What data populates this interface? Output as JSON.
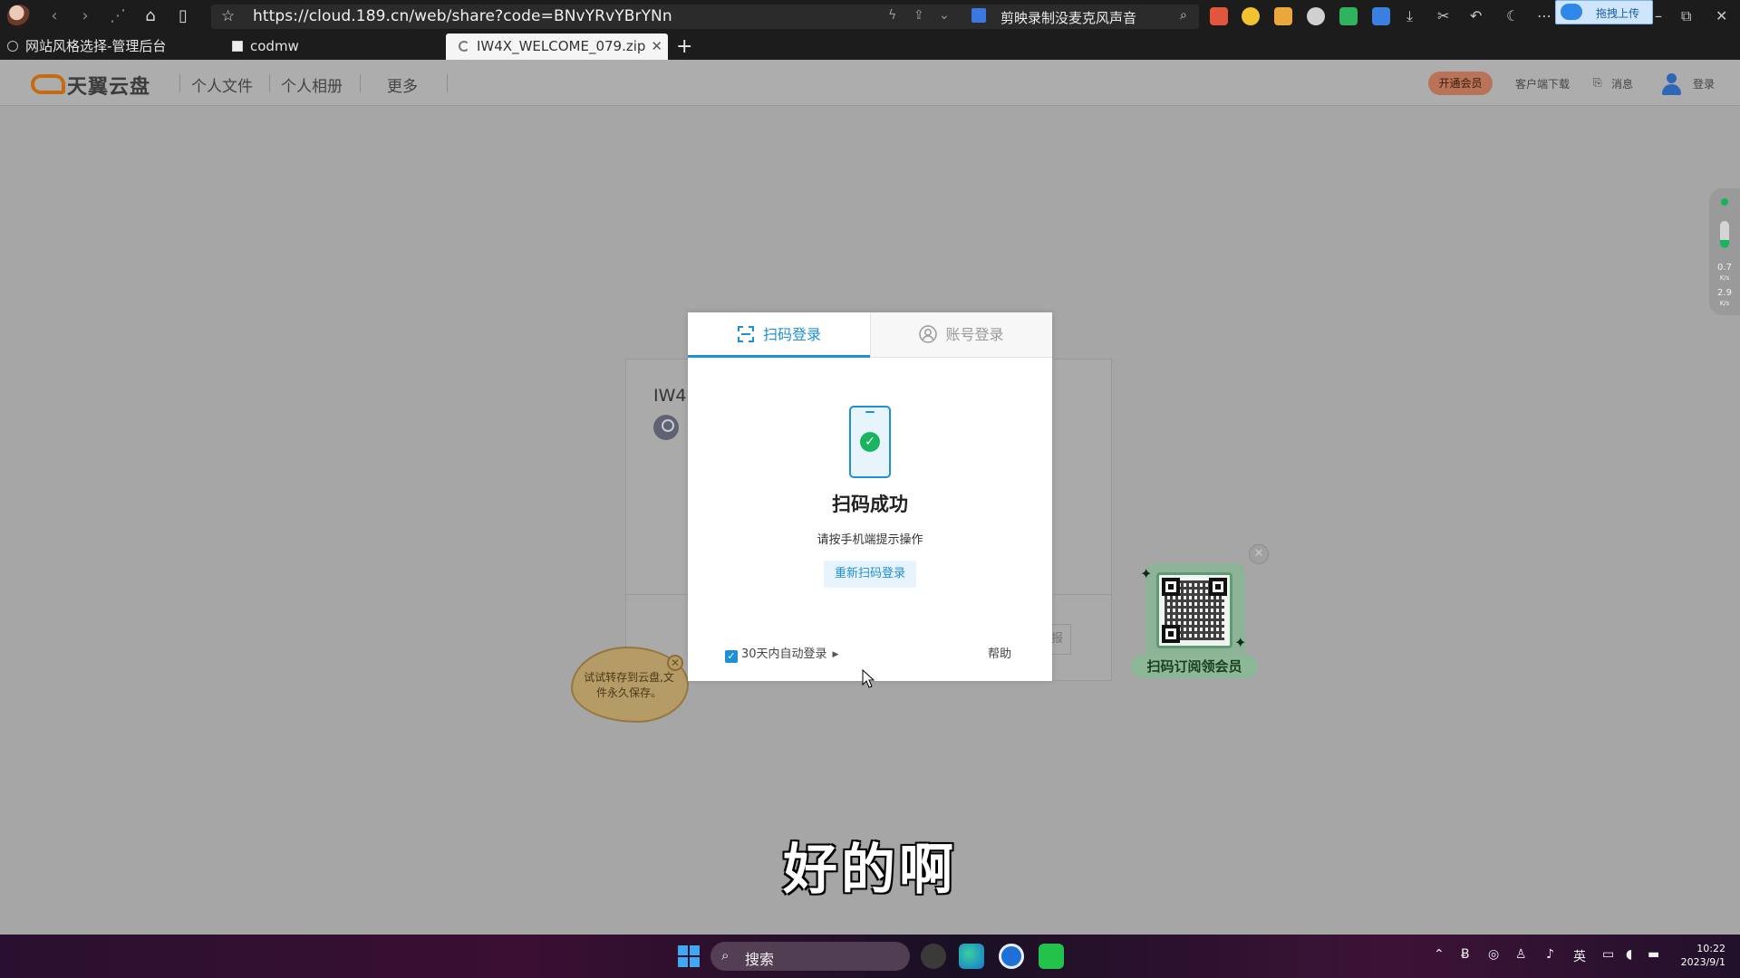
{
  "browser": {
    "url": "https://cloud.189.cn/web/share?code=BNvYRvYBrYNn",
    "search_text": "剪映录制没麦克风声音",
    "upload_label": "拖拽上传",
    "tabs": [
      {
        "label": "网站风格选择-管理后台"
      },
      {
        "label": "codmw"
      },
      {
        "label": "IW4X_WELCOME_079.zip"
      }
    ]
  },
  "site": {
    "logo_text": "天翼云盘",
    "nav": [
      "个人文件",
      "个人相册",
      "更多"
    ],
    "vip_label": "开通会员",
    "client_download": "客户端下载",
    "messages": "消息",
    "login": "登录"
  },
  "share": {
    "title_partial": "IW4",
    "ghost_btn": "报"
  },
  "tip": {
    "text": "试试转存到云盘,文件永久保存。"
  },
  "promo": {
    "label": "扫码订阅领会员"
  },
  "speed_widget": {
    "up": "0.7",
    "down": "2.9",
    "unit": "K/s",
    "level_fraction": 0.3
  },
  "modal": {
    "tab_qr": "扫码登录",
    "tab_account": "账号登录",
    "status_title": "扫码成功",
    "status_sub": "请按手机端提示操作",
    "rescan_label": "重新扫码登录",
    "remember_label": "30天内自动登录",
    "remember_checked": true,
    "help_label": "帮助"
  },
  "subtitle": "好的啊",
  "taskbar": {
    "search_placeholder": "搜索",
    "ime": "英",
    "time": "10:22",
    "date": "2023/9/1"
  },
  "colors": {
    "accent": "#1f8fd6",
    "success": "#1bb45e",
    "vip": "#b87358"
  }
}
